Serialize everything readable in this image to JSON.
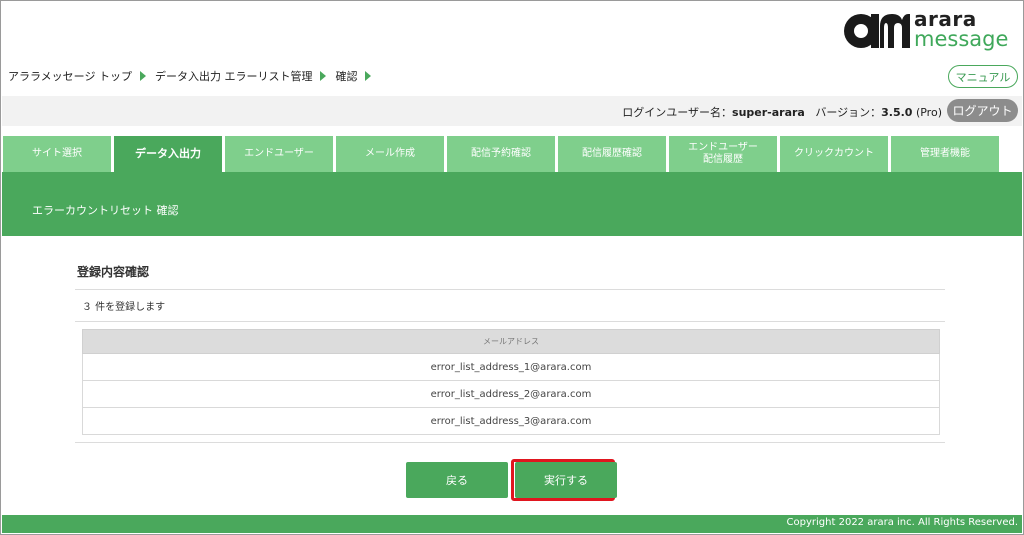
{
  "logo": {
    "line1": "arara",
    "line2": "message",
    "mark_color": "#1a1a1a"
  },
  "breadcrumb": [
    "アララメッセージ トップ",
    "データ入出力 エラーリスト管理",
    "確認"
  ],
  "manual_label": "マニュアル",
  "login": {
    "user_label": "ログインユーザー名：",
    "user_name": "super-arara",
    "version_label": "バージョン：",
    "version": "3.5.0",
    "edition": "(Pro)",
    "logout_label": "ログアウト"
  },
  "tabs": [
    {
      "label": "サイト選択",
      "active": false
    },
    {
      "label": "データ入出力",
      "active": true
    },
    {
      "label": "エンドユーザー",
      "active": false
    },
    {
      "label": "メール作成",
      "active": false
    },
    {
      "label": "配信予約確認",
      "active": false
    },
    {
      "label": "配信履歴確認",
      "active": false
    },
    {
      "label": "エンドユーザー\n配信履歴",
      "active": false
    },
    {
      "label": "クリックカウント",
      "active": false
    },
    {
      "label": "管理者機能",
      "active": false
    }
  ],
  "page_header": "エラーカウントリセット 確認",
  "content": {
    "section_title": "登録内容確認",
    "count_text": "３ 件を登録します",
    "table": {
      "header": "メールアドレス",
      "rows": [
        "error_list_address_1@arara.com",
        "error_list_address_2@arara.com",
        "error_list_address_3@arara.com"
      ]
    }
  },
  "buttons": {
    "back": "戻る",
    "execute": "実行する"
  },
  "footer": {
    "copyright": "Copyright 2022 arara inc. All Rights Reserved."
  },
  "colors": {
    "accent": "#4aa85c",
    "tab_inactive": "#7fcf8c",
    "highlight": "#e0161f"
  }
}
